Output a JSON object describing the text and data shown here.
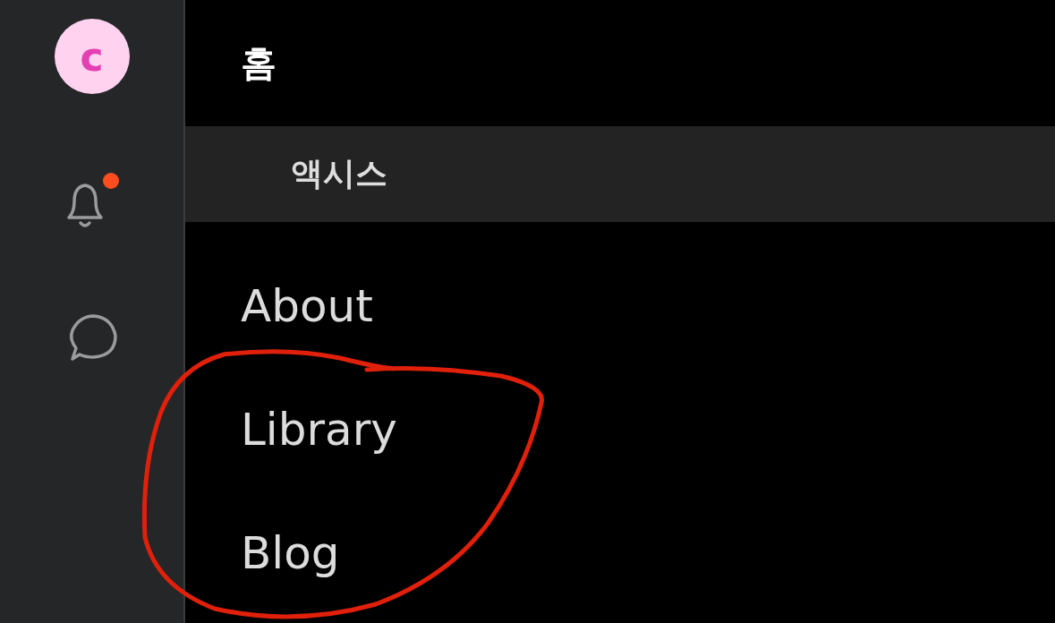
{
  "sidebar": {
    "avatar": {
      "letter": "c"
    },
    "notifications": {
      "unread": true
    }
  },
  "title": "홈",
  "tabs": [
    {
      "label": "액시스",
      "selected": true
    }
  ],
  "links": [
    {
      "label": "About"
    },
    {
      "label": "Library"
    },
    {
      "label": "Blog"
    }
  ]
}
